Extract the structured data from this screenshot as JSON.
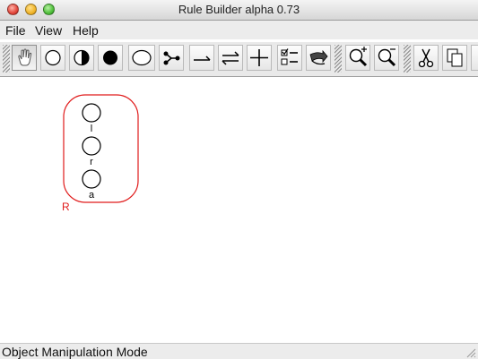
{
  "window": {
    "title": "Rule Builder alpha 0.73"
  },
  "menu": {
    "file": "File",
    "view": "View",
    "help": "Help"
  },
  "toolbar": {
    "buttons": [
      {
        "icon": "hand-icon",
        "pressed": true
      },
      {
        "icon": "empty-circle-icon"
      },
      {
        "icon": "half-circle-icon"
      },
      {
        "icon": "filled-circle-icon"
      },
      {
        "icon": "ellipse-icon"
      },
      {
        "icon": "branch-icon"
      },
      {
        "icon": "single-arrow-icon"
      },
      {
        "icon": "double-arrow-icon"
      },
      {
        "icon": "plus-icon"
      },
      {
        "icon": "checklist-icon"
      },
      {
        "icon": "export-icon"
      },
      {
        "icon": "zoom-in-icon"
      },
      {
        "icon": "zoom-out-icon"
      },
      {
        "icon": "scissors-icon"
      },
      {
        "icon": "copy-icon"
      }
    ]
  },
  "rule": {
    "label": "R",
    "nodes": [
      "l",
      "r",
      "a"
    ]
  },
  "status": {
    "text": "Object Manipulation Mode"
  },
  "colors": {
    "rule_border": "#e01a1a",
    "rule_label": "#e01a1a"
  }
}
